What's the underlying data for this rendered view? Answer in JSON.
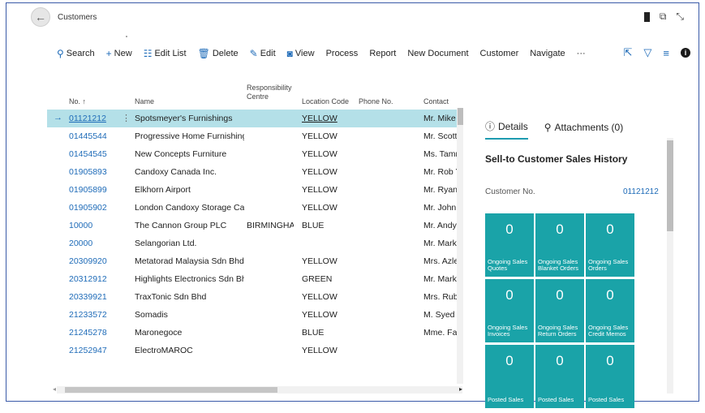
{
  "page": {
    "title": "Customers"
  },
  "toolbar": {
    "search": "Search",
    "new": "New",
    "edit_list": "Edit List",
    "delete": "Delete",
    "edit": "Edit",
    "view": "View",
    "process": "Process",
    "report": "Report",
    "new_document": "New Document",
    "customer": "Customer",
    "navigate": "Navigate",
    "more": "···"
  },
  "table": {
    "columns": {
      "no": "No. ↑",
      "name": "Name",
      "responsibility_centre": "Responsibility Centre",
      "location_code": "Location Code",
      "phone_no": "Phone No.",
      "contact": "Contact"
    },
    "rows": [
      {
        "no": "01121212",
        "name": "Spotsmeyer's Furnishings",
        "resp": "",
        "loc": "YELLOW",
        "phone": "",
        "contact": "Mr. Mike I"
      },
      {
        "no": "01445544",
        "name": "Progressive Home Furnishings",
        "resp": "",
        "loc": "YELLOW",
        "phone": "",
        "contact": "Mr. Scott"
      },
      {
        "no": "01454545",
        "name": "New Concepts Furniture",
        "resp": "",
        "loc": "YELLOW",
        "phone": "",
        "contact": "Ms. Tamm"
      },
      {
        "no": "01905893",
        "name": "Candoxy Canada Inc.",
        "resp": "",
        "loc": "YELLOW",
        "phone": "",
        "contact": "Mr. Rob Yc"
      },
      {
        "no": "01905899",
        "name": "Elkhorn Airport",
        "resp": "",
        "loc": "YELLOW",
        "phone": "",
        "contact": "Mr. Ryan I"
      },
      {
        "no": "01905902",
        "name": "London Candoxy Storage Cam...",
        "resp": "",
        "loc": "YELLOW",
        "phone": "",
        "contact": "Mr. John I"
      },
      {
        "no": "10000",
        "name": "The Cannon Group PLC",
        "resp": "BIRMINGHAM",
        "loc": "BLUE",
        "phone": "",
        "contact": "Mr. Andy"
      },
      {
        "no": "20000",
        "name": "Selangorian Ltd.",
        "resp": "",
        "loc": "",
        "phone": "",
        "contact": "Mr. Mark"
      },
      {
        "no": "20309920",
        "name": "Metatorad Malaysia Sdn Bhd",
        "resp": "",
        "loc": "YELLOW",
        "phone": "",
        "contact": "Mrs. Azlee"
      },
      {
        "no": "20312912",
        "name": "Highlights Electronics Sdn Bhd",
        "resp": "",
        "loc": "GREEN",
        "phone": "",
        "contact": "Mr. Mark"
      },
      {
        "no": "20339921",
        "name": "TraxTonic Sdn Bhd",
        "resp": "",
        "loc": "YELLOW",
        "phone": "",
        "contact": "Mrs. Rubir"
      },
      {
        "no": "21233572",
        "name": "Somadis",
        "resp": "",
        "loc": "YELLOW",
        "phone": "",
        "contact": "M. Syed A"
      },
      {
        "no": "21245278",
        "name": "Maronegoce",
        "resp": "",
        "loc": "BLUE",
        "phone": "",
        "contact": "Mme. Fad"
      },
      {
        "no": "21252947",
        "name": "ElectroMAROC",
        "resp": "",
        "loc": "YELLOW",
        "phone": "",
        "contact": ""
      }
    ]
  },
  "factbox": {
    "tabs": {
      "details": "Details",
      "attachments": "Attachments (0)"
    },
    "heading": "Sell-to Customer Sales History",
    "customer_no_label": "Customer No.",
    "customer_no_value": "01121212",
    "tiles": [
      {
        "value": "0",
        "label": "Ongoing Sales Quotes"
      },
      {
        "value": "0",
        "label": "Ongoing Sales Blanket Orders"
      },
      {
        "value": "0",
        "label": "Ongoing Sales Orders"
      },
      {
        "value": "0",
        "label": "Ongoing Sales Invoices"
      },
      {
        "value": "0",
        "label": "Ongoing Sales Return Orders"
      },
      {
        "value": "0",
        "label": "Ongoing Sales Credit Memos"
      },
      {
        "value": "0",
        "label": "Posted Sales"
      },
      {
        "value": "0",
        "label": "Posted Sales"
      },
      {
        "value": "0",
        "label": "Posted Sales"
      }
    ]
  },
  "colors": {
    "accent": "#1e6bb8",
    "selected_row": "#b4e0e8",
    "tile": "#1aa3a8"
  }
}
